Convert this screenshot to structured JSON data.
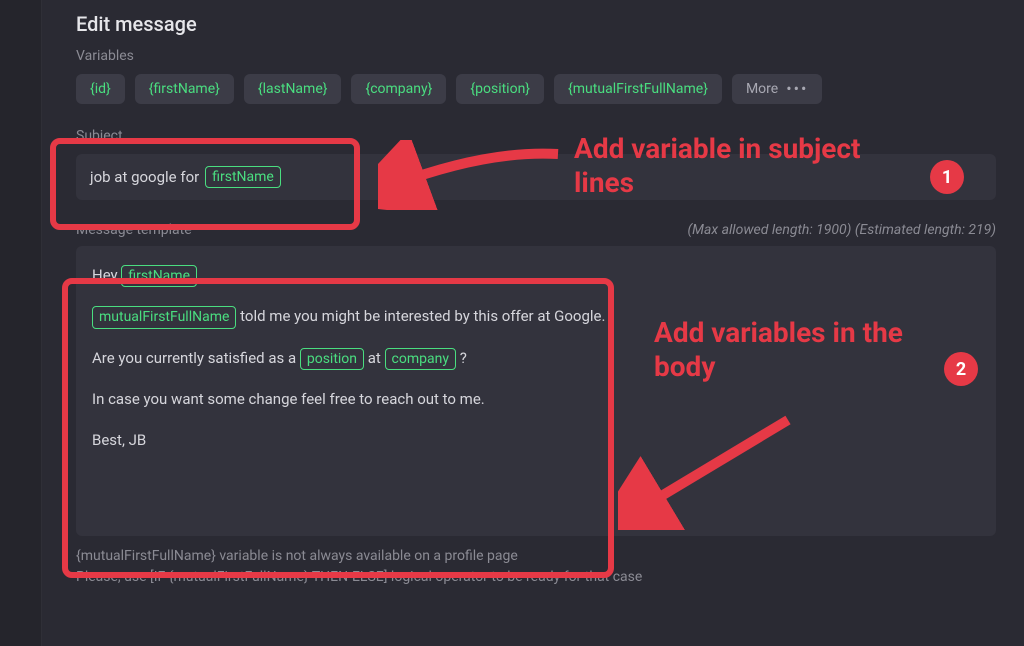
{
  "title": "Edit message",
  "variables": {
    "label": "Variables",
    "chips": [
      "{id}",
      "{firstName}",
      "{lastName}",
      "{company}",
      "{position}",
      "{mutualFirstFullName}"
    ],
    "more_label": "More"
  },
  "subject": {
    "label": "Subject",
    "prefix": "job at google for",
    "var": "firstName"
  },
  "template": {
    "label": "Message template",
    "max_text": "(Max allowed length: 1900)",
    "est_text": "(Estimated length: 219)",
    "line1_pre": "Hey ",
    "line1_var": "firstName",
    "line1_post": " ,",
    "line2_var": "mutualFirstFullName",
    "line2_post": " told me you might be interested by this offer at Google.",
    "line3_pre": "Are you currently satisfied as a ",
    "line3_var1": "position",
    "line3_mid": " at ",
    "line3_var2": "company",
    "line3_post": " ?",
    "line4": "In case you want some change feel free to reach out to me.",
    "line5": "Best, JB"
  },
  "footer": {
    "line1": "{mutualFirstFullName} variable is not always available on a profile page",
    "line2": "Please, use [IF {mutualFirstFullName} THEN-ELSE] logical operator to be ready for that case"
  },
  "annotations": {
    "callout1": "Add variable in subject lines",
    "callout2": "Add variables in the body",
    "badge1": "1",
    "badge2": "2"
  }
}
